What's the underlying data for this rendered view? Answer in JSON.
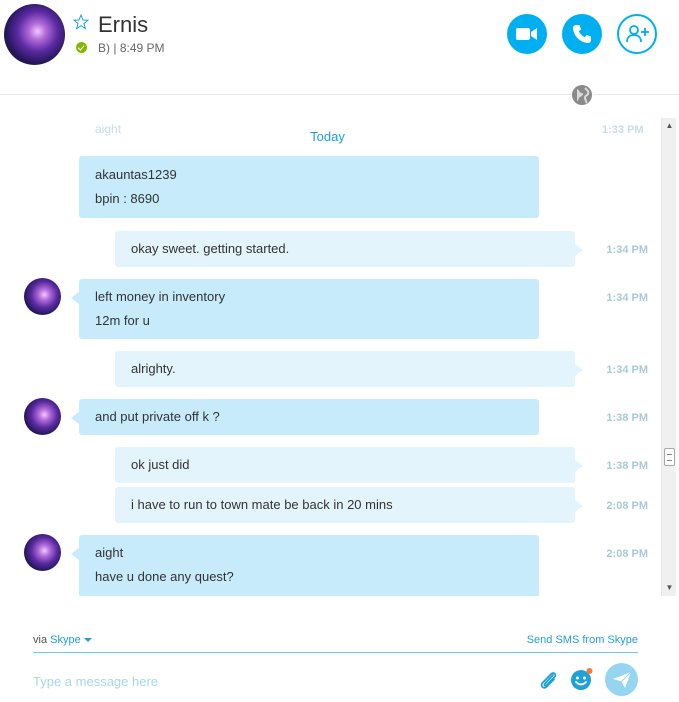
{
  "contact": {
    "name": "Ernis",
    "mood": "B)",
    "separator": "|",
    "local_time": "8:49 PM"
  },
  "colors": {
    "accent": "#00aff0",
    "incoming_bubble": "#c7ebfb",
    "outgoing_bubble": "#e3f4fc",
    "presence_online": "#7fba00",
    "timestamp": "#a8c9da"
  },
  "icons": {
    "favorite": "star-icon",
    "status": "online-check-icon",
    "video": "video-camera-icon",
    "call": "phone-icon",
    "add": "add-contact-icon",
    "globe": "globe-icon",
    "attach": "paperclip-icon",
    "emoji": "emoticon-icon",
    "send": "send-icon"
  },
  "chat": {
    "date_divider": "Today",
    "ghost_text": [
      "aight",
      "1:33 PM"
    ],
    "messages": [
      {
        "dir": "in",
        "lines": [
          "akauntas1239",
          "bpin : 8690"
        ],
        "time": ""
      },
      {
        "dir": "out",
        "lines": [
          "okay sweet. getting started."
        ],
        "time": "1:34 PM"
      },
      {
        "dir": "in",
        "lines": [
          "left money in inventory",
          "12m for u"
        ],
        "time": "1:34 PM"
      },
      {
        "dir": "out",
        "lines": [
          "alrighty."
        ],
        "time": "1:34 PM"
      },
      {
        "dir": "in",
        "lines": [
          "and put private off k ?"
        ],
        "time": "1:38 PM"
      },
      {
        "dir": "out",
        "lines": [
          "ok just did"
        ],
        "time": "1:38 PM"
      },
      {
        "dir": "out",
        "lines": [
          "i have to run to town mate be back in 20 mins"
        ],
        "time": "2:08 PM"
      },
      {
        "dir": "in",
        "lines": [
          "aight",
          "have u done any quest?"
        ],
        "time": "2:08 PM"
      }
    ]
  },
  "footer": {
    "via_label": "via",
    "via_service": "Skype",
    "sms_link": "Send SMS from Skype",
    "input_placeholder": "Type a message here"
  }
}
